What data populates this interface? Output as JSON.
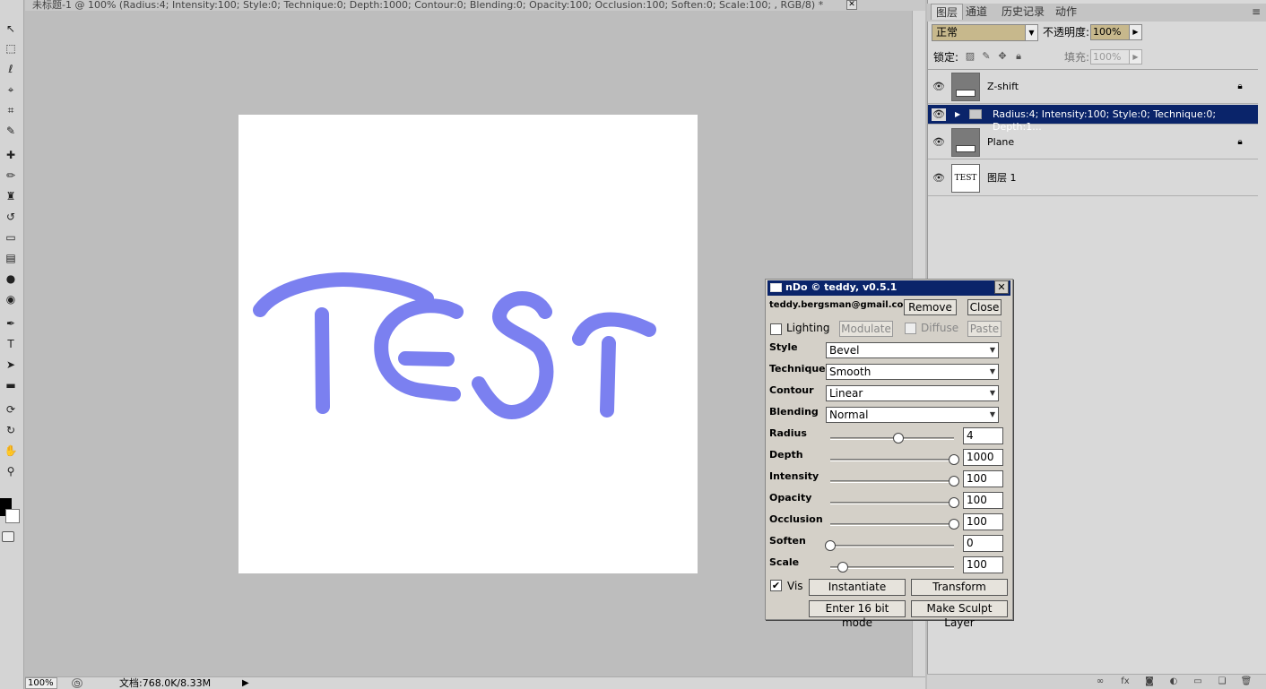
{
  "document": {
    "title": "未标题-1 @ 100% (Radius:4; Intensity:100; Style:0; Technique:0; Depth:1000; Contour:0; Blending:0; Opacity:100; Occlusion:100; Soften:0; Scale:100; , RGB/8) *",
    "close_glyph": "✕",
    "zoom": "100%",
    "doc_size": "文档:768.0K/8.33M",
    "canvas_text": "TEST",
    "stroke_color": "#7b80f0"
  },
  "toolbar": {
    "tools": [
      {
        "icon": "move-icon",
        "glyph": "↖"
      },
      {
        "icon": "marquee-icon",
        "glyph": "⬚"
      },
      {
        "icon": "lasso-icon",
        "glyph": "ℓ"
      },
      {
        "icon": "quick-select-icon",
        "glyph": "⌖"
      },
      {
        "icon": "crop-icon",
        "glyph": "⌗"
      },
      {
        "icon": "eyedropper-icon",
        "glyph": "✎"
      },
      {
        "icon": "healing-brush-icon",
        "glyph": "✚"
      },
      {
        "icon": "brush-icon",
        "glyph": "✏"
      },
      {
        "icon": "clone-stamp-icon",
        "glyph": "♜"
      },
      {
        "icon": "history-brush-icon",
        "glyph": "↺"
      },
      {
        "icon": "eraser-icon",
        "glyph": "▭"
      },
      {
        "icon": "gradient-icon",
        "glyph": "▤"
      },
      {
        "icon": "blur-icon",
        "glyph": "●"
      },
      {
        "icon": "dodge-icon",
        "glyph": "◉"
      },
      {
        "icon": "pen-icon",
        "glyph": "✒"
      },
      {
        "icon": "type-icon",
        "glyph": "T"
      },
      {
        "icon": "path-select-icon",
        "glyph": "➤"
      },
      {
        "icon": "rectangle-icon",
        "glyph": "▬"
      },
      {
        "icon": "3d-rotate-icon",
        "glyph": "⟳"
      },
      {
        "icon": "3d-orbit-icon",
        "glyph": "↻"
      },
      {
        "icon": "hand-icon",
        "glyph": "✋"
      },
      {
        "icon": "zoom-icon",
        "glyph": "⚲"
      }
    ]
  },
  "panel": {
    "tabs": [
      "图层",
      "通道",
      "历史记录",
      "动作"
    ],
    "menu_glyph": "≡",
    "blend_mode": "正常",
    "opacity_label": "不透明度:",
    "opacity_value": "100%",
    "lock_label": "锁定:",
    "fill_label": "填充:",
    "fill_value": "100%",
    "layers": [
      {
        "name": "Z-shift",
        "thumb": "gray",
        "locked": true,
        "selected": false
      },
      {
        "name": "Radius:4; Intensity:100; Style:0; Technique:0; Depth:1...",
        "thumb": "folder",
        "locked": false,
        "selected": true
      },
      {
        "name": "Plane",
        "thumb": "gray",
        "locked": true,
        "selected": false
      },
      {
        "name": "图层 1",
        "thumb": "text",
        "thumb_text": "TEST",
        "locked": false,
        "selected": false
      }
    ]
  },
  "ndo": {
    "title": "nDo © teddy, v0.5.1",
    "email": "teddy.bergsman@gmail.com",
    "remove_label": "Remove",
    "close_label": "Close",
    "lighting_label": "Lighting",
    "modulate_label": "Modulate",
    "diffuse_label": "Diffuse",
    "paste_label": "Paste",
    "dropdowns": [
      {
        "label": "Style",
        "value": "Bevel"
      },
      {
        "label": "Technique",
        "value": "Smooth"
      },
      {
        "label": "Contour",
        "value": "Linear"
      },
      {
        "label": "Blending",
        "value": "Normal"
      }
    ],
    "sliders": [
      {
        "label": "Radius",
        "value": "4",
        "fraction": 0.55
      },
      {
        "label": "Depth",
        "value": "1000",
        "fraction": 1.0
      },
      {
        "label": "Intensity",
        "value": "100",
        "fraction": 1.0
      },
      {
        "label": "Opacity",
        "value": "100",
        "fraction": 1.0
      },
      {
        "label": "Occlusion",
        "value": "100",
        "fraction": 1.0
      },
      {
        "label": "Soften",
        "value": "0",
        "fraction": 0.0
      },
      {
        "label": "Scale",
        "value": "100",
        "fraction": 0.1
      }
    ],
    "vis_label": "Vis",
    "vis_checked": true,
    "instantiate_label": "Instantiate",
    "transform_label": "Transform",
    "enter16_label": "Enter 16 bit mode",
    "sculpt_label": "Make Sculpt Layer"
  }
}
